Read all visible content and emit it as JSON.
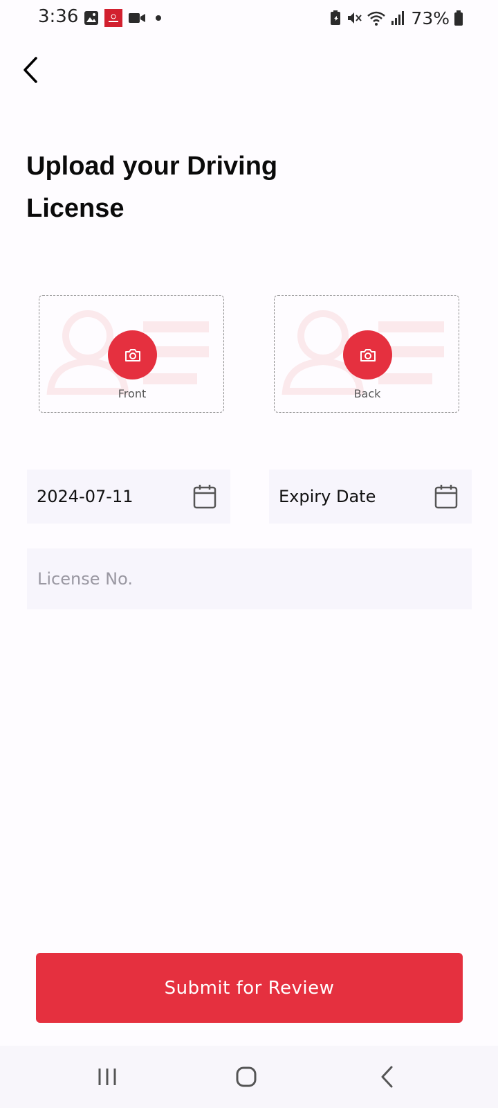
{
  "status_bar": {
    "time": "3:36",
    "battery": "73%",
    "left_icons": [
      "gallery-icon",
      "app-notification-icon",
      "video-camera-icon",
      "dot-icon"
    ],
    "right_icons": [
      "battery-saver-icon",
      "mute-icon",
      "wifi-icon",
      "signal-icon",
      "battery-icon"
    ]
  },
  "header": {
    "back_icon": "chevron-left-icon",
    "title": "Upload your Driving License"
  },
  "uploads": {
    "front_label": "Front",
    "back_label": "Back",
    "camera_icon": "camera-icon"
  },
  "fields": {
    "issue_date_value": "2024-07-11",
    "expiry_date_placeholder": "Expiry Date",
    "license_placeholder": "License No.",
    "calendar_icon": "calendar-icon"
  },
  "actions": {
    "submit_label": "Submit for Review"
  },
  "colors": {
    "accent": "#e5303f",
    "field_bg": "#f7f5fc",
    "placeholder_art": "#fbe9ec"
  },
  "nav_bar": {
    "icons": [
      "recents-icon",
      "home-icon",
      "back-icon"
    ]
  }
}
